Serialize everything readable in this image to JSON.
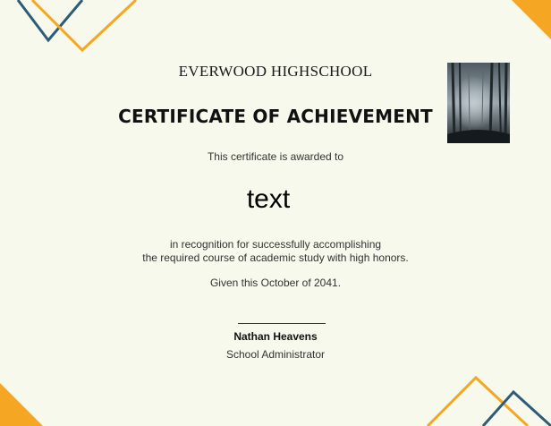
{
  "certificate": {
    "school_name": "EVERWOOD HIGHSCHOOL",
    "title": "CERTIFICATE OF ACHIEVEMENT",
    "awarded_text": "This certificate is awarded to",
    "recipient_name": "text",
    "recognition_line1": "in recognition for successfully accomplishing",
    "recognition_line2": "the required course of academic study with high honors.",
    "given_text": "Given this October of 2041.",
    "signer_name": "Nathan Heavens",
    "signer_role": "School Administrator"
  },
  "colors": {
    "background": "#f6f9ec",
    "accent_orange": "#f5a623",
    "accent_blue": "#2e5b78"
  },
  "photo": {
    "icon": "misty-forest-image"
  }
}
